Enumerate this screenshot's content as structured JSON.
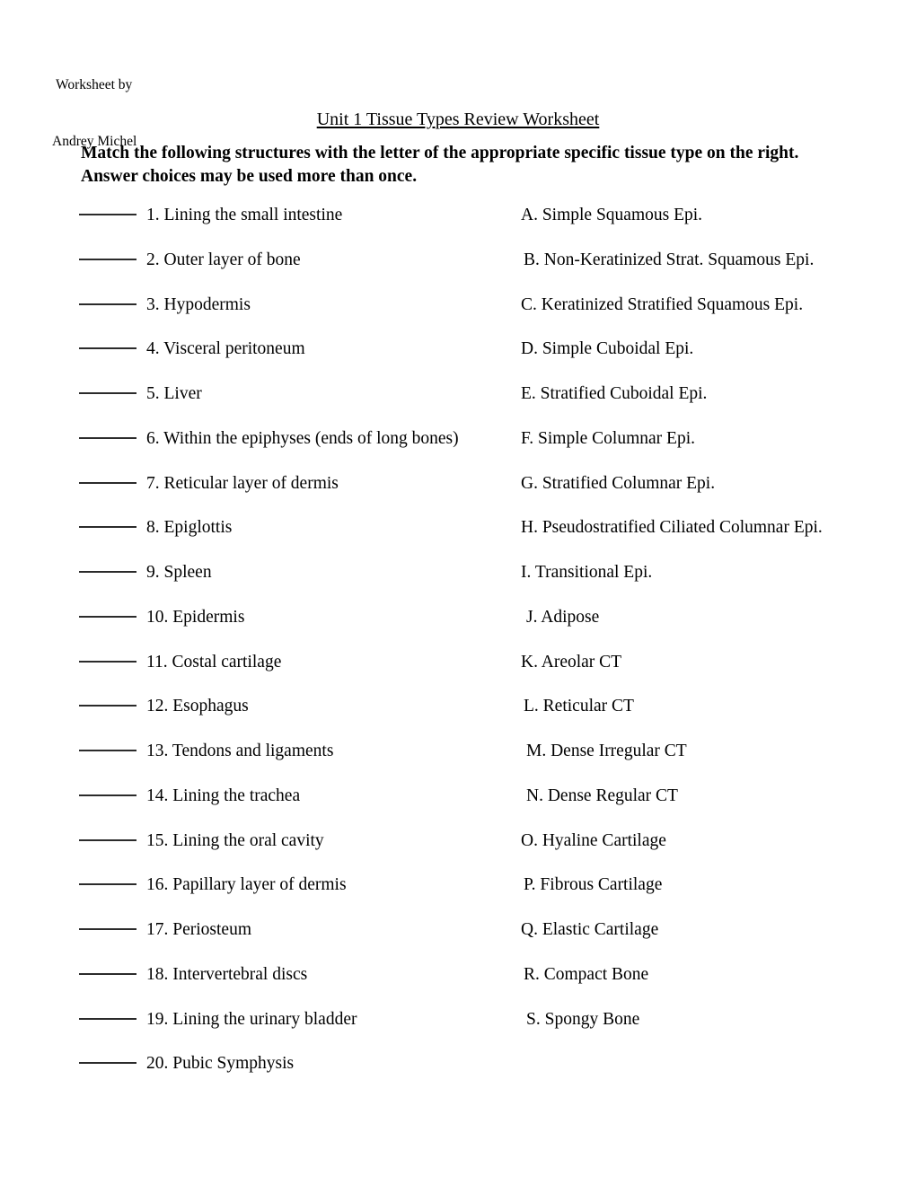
{
  "header": {
    "byline_line_1": "Worksheet by",
    "byline_line_2": "Andrey Michel"
  },
  "title": "Unit 1 Tissue Types Review Worksheet",
  "instructions": "Match the following structures with the letter of the appropriate specific tissue type on the right. Answer choices may be used more than once.",
  "rows": [
    {
      "item": "1. Lining the small intestine",
      "choice": "A. Simple Squamous Epi.",
      "choice_indent": 0
    },
    {
      "item": "2. Outer layer of bone",
      "choice": "B. Non-Keratinized Strat. Squamous Epi.",
      "choice_indent": 1
    },
    {
      "item": "3. Hypodermis",
      "choice": "C. Keratinized Stratified Squamous Epi.",
      "choice_indent": 0
    },
    {
      "item": "4. Visceral peritoneum",
      "choice": "D. Simple Cuboidal Epi.",
      "choice_indent": 0
    },
    {
      "item": "5. Liver",
      "choice": "E. Stratified Cuboidal Epi.",
      "choice_indent": 0
    },
    {
      "item": "6. Within the epiphyses (ends of long bones)",
      "choice": "F. Simple Columnar Epi.",
      "choice_indent": 0
    },
    {
      "item": "7. Reticular layer of dermis",
      "choice": "G. Stratified Columnar Epi.",
      "choice_indent": 0
    },
    {
      "item": "8. Epiglottis",
      "choice": "H. Pseudostratified Ciliated Columnar Epi.",
      "choice_indent": 0
    },
    {
      "item": "9. Spleen",
      "choice": "I. Transitional Epi.",
      "choice_indent": 0
    },
    {
      "item": "10. Epidermis",
      "choice": "J. Adipose",
      "choice_indent": 2
    },
    {
      "item": "11. Costal cartilage",
      "choice": "K. Areolar CT",
      "choice_indent": 0
    },
    {
      "item": "12. Esophagus",
      "choice": "L. Reticular CT",
      "choice_indent": 1
    },
    {
      "item": "13. Tendons and ligaments",
      "choice": "M. Dense Irregular CT",
      "choice_indent": 2
    },
    {
      "item": "14. Lining the trachea",
      "choice": "N. Dense Regular CT",
      "choice_indent": 2
    },
    {
      "item": "15. Lining the oral cavity",
      "choice": "O. Hyaline Cartilage",
      "choice_indent": 0
    },
    {
      "item": "16. Papillary layer of dermis",
      "choice": "P. Fibrous Cartilage",
      "choice_indent": 1
    },
    {
      "item": "17. Periosteum",
      "choice": "Q. Elastic Cartilage",
      "choice_indent": 0
    },
    {
      "item": "18. Intervertebral discs",
      "choice": "R. Compact Bone",
      "choice_indent": 1
    },
    {
      "item": "19. Lining the urinary bladder",
      "choice": "S. Spongy Bone",
      "choice_indent": 2
    },
    {
      "item": "20. Pubic Symphysis",
      "choice": "",
      "choice_indent": 0
    }
  ]
}
